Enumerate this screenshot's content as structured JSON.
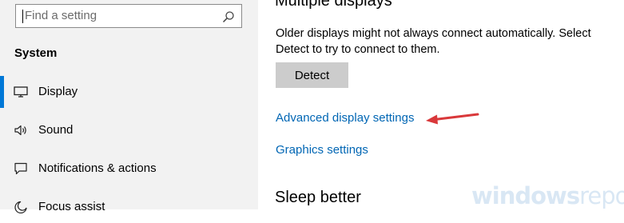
{
  "search": {
    "placeholder": "Find a setting"
  },
  "sidebar": {
    "section_title": "System",
    "items": [
      {
        "label": "Display",
        "icon": "monitor-icon",
        "selected": true
      },
      {
        "label": "Sound",
        "icon": "speaker-icon",
        "selected": false
      },
      {
        "label": "Notifications & actions",
        "icon": "notification-icon",
        "selected": false
      },
      {
        "label": "Focus assist",
        "icon": "moon-icon",
        "selected": false
      }
    ]
  },
  "main": {
    "top_heading": "Multiple displays",
    "description": "Older displays might not always connect automatically. Select Detect to try to connect to them.",
    "detect_label": "Detect",
    "advanced_link": "Advanced display settings",
    "graphics_link": "Graphics settings",
    "sleep_heading": "Sleep better"
  },
  "watermark": {
    "bold": "windows",
    "light": "report"
  },
  "colors": {
    "accent": "#0078d7",
    "link": "#0066b4",
    "arrow": "#d9383a",
    "sidebar_bg": "#f2f2f2"
  }
}
